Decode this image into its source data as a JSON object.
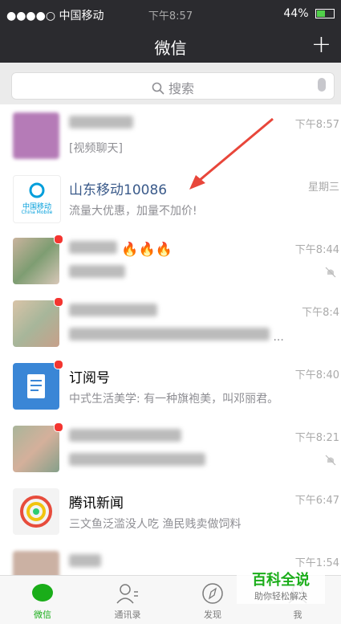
{
  "status": {
    "carrier": "●●●●○ 中国移动",
    "time": "下午8:57",
    "battery": "44%"
  },
  "nav": {
    "title": "微信",
    "plus": "+"
  },
  "search": {
    "placeholder": "搜索"
  },
  "chats": [
    {
      "name": "",
      "msg": "[视频聊天]",
      "time": "下午8:57"
    },
    {
      "name": "山东移动10086",
      "msg": "流量大优惠，加量不加价!",
      "time": "星期三"
    },
    {
      "name": "🔥🔥🔥",
      "msg": "",
      "time": "下午8:44"
    },
    {
      "name": "",
      "msg": "...",
      "time": "下午8:4"
    },
    {
      "name": "订阅号",
      "msg": "中式生活美学: 有一种旗袍美，叫邓丽君。",
      "time": "下午8:40"
    },
    {
      "name": "",
      "msg": "",
      "time": "下午8:21"
    },
    {
      "name": "腾讯新闻",
      "msg": "三文鱼泛滥没人吃 渔民贱卖做饲料",
      "time": "下午6:47"
    },
    {
      "name": "",
      "msg": "",
      "time": "下午1:54"
    }
  ],
  "china_mobile_logo": {
    "cn": "中国移动",
    "en": "China Mobile"
  },
  "tabs": [
    {
      "label": "微信"
    },
    {
      "label": "通讯录"
    },
    {
      "label": "发现"
    },
    {
      "label": "我"
    }
  ],
  "watermark": {
    "title": "百科全说",
    "sub": "助你轻松解决"
  },
  "colors": {
    "accent": "#1aad19",
    "navbar": "#2b2b2f",
    "badge": "#f43530",
    "arrow": "#e8463a"
  }
}
